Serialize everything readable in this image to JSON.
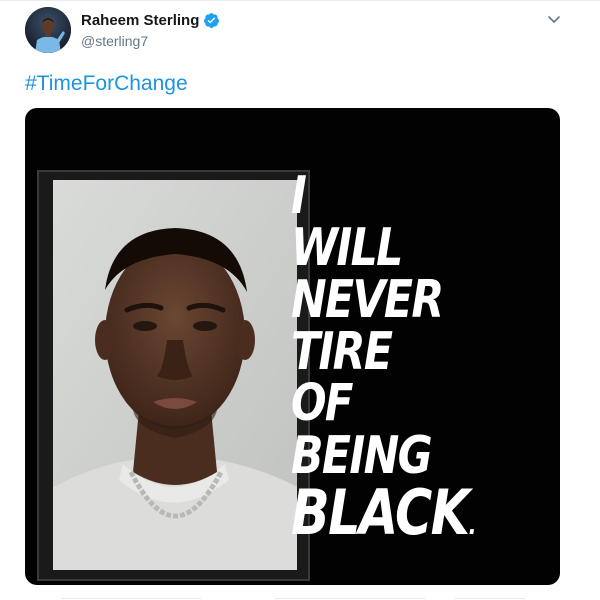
{
  "tweet": {
    "author": {
      "display_name": "Raheem Sterling",
      "handle": "@sterling7",
      "verified": true
    },
    "text": "#TimeForChange",
    "media": {
      "slogan_lines": [
        "I",
        "WILL",
        "NEVER",
        "TIRE",
        "OF",
        "BEING",
        "BLACK"
      ],
      "slogan_end": "."
    },
    "icons": {
      "verified": "verified-badge-icon",
      "menu": "chevron-down-icon"
    }
  },
  "colors": {
    "link": "#1b95e0",
    "verified": "#1da1f2",
    "name": "#14171a",
    "handle": "#657786",
    "media_background": "#020202"
  }
}
